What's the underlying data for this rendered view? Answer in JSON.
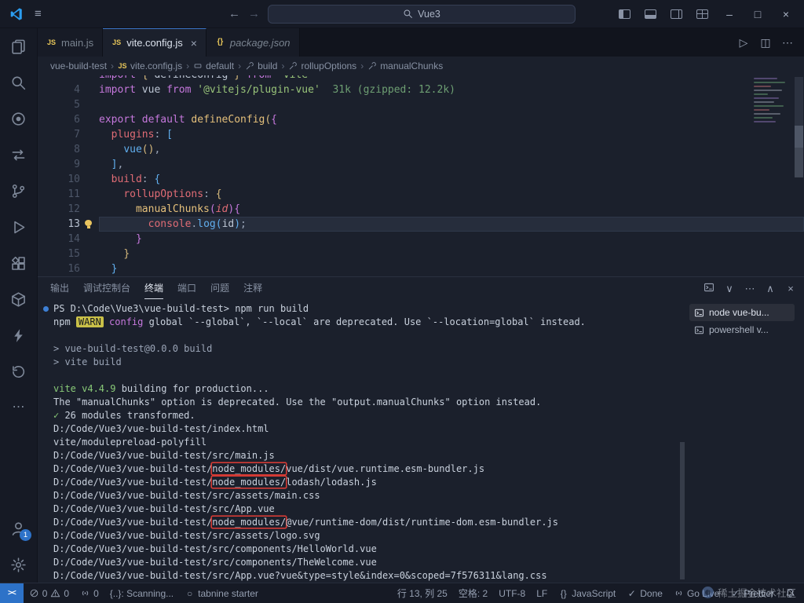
{
  "titlebar": {
    "menu_icon": "≡",
    "back": "←",
    "forward": "→",
    "search_value": "Vue3",
    "minimize": "–",
    "maximize": "□",
    "close": "×"
  },
  "activity_bar": {
    "top_items": [
      {
        "name": "explorer",
        "icon": "files"
      },
      {
        "name": "search",
        "icon": "search"
      },
      {
        "name": "chat",
        "icon": "chat"
      },
      {
        "name": "compare",
        "icon": "compare"
      },
      {
        "name": "source-control",
        "icon": "branch"
      },
      {
        "name": "run-debug",
        "icon": "debug"
      },
      {
        "name": "extensions",
        "icon": "extensions"
      },
      {
        "name": "package",
        "icon": "box"
      },
      {
        "name": "thunder-client",
        "icon": "bolt"
      },
      {
        "name": "history",
        "icon": "history"
      },
      {
        "name": "more-views",
        "icon": "kebab"
      }
    ],
    "bottom_items": [
      {
        "name": "accounts",
        "icon": "person",
        "badge": "1"
      },
      {
        "name": "settings",
        "icon": "gear"
      }
    ]
  },
  "editor_tabs": [
    {
      "label": "main.js",
      "icon": "js",
      "active": false
    },
    {
      "label": "vite.config.js",
      "icon": "js",
      "active": true,
      "close": "×"
    },
    {
      "label": "package.json",
      "icon": "json",
      "active": false,
      "preview": true
    }
  ],
  "tab_actions": [
    {
      "name": "run-file",
      "icon": "play"
    },
    {
      "name": "split-editor",
      "icon": "split"
    },
    {
      "name": "editor-more",
      "icon": "kebab"
    }
  ],
  "breadcrumbs": [
    {
      "label": "vue-build-test"
    },
    {
      "label": "vite.config.js",
      "icon": "js"
    },
    {
      "label": "default",
      "icon": "symbol-field"
    },
    {
      "label": "build",
      "icon": "wrench"
    },
    {
      "label": "rollupOptions",
      "icon": "wrench"
    },
    {
      "label": "manualChunks",
      "icon": "wrench"
    }
  ],
  "editor": {
    "active_line": 13,
    "partial_top_tokens": [
      [
        "kw",
        "import "
      ],
      [
        "bY",
        "{ "
      ],
      [
        "t",
        "defineConfig "
      ],
      [
        "bY",
        "} "
      ],
      [
        "kw",
        "from "
      ],
      [
        "str",
        "'vite'"
      ]
    ],
    "lines": [
      {
        "num": 4,
        "tokens": [
          [
            "kw",
            "import "
          ],
          [
            "t",
            "vue "
          ],
          [
            "kw",
            "from "
          ],
          [
            "str",
            "'@vitejs/plugin-vue'"
          ],
          [
            "hint",
            "  31k (gzipped: 12.2k)"
          ]
        ]
      },
      {
        "num": 5,
        "tokens": []
      },
      {
        "num": 6,
        "tokens": [
          [
            "kw",
            "export "
          ],
          [
            "kw",
            "default "
          ],
          [
            "fn",
            "defineConfig"
          ],
          [
            "bY",
            "("
          ],
          [
            "bP",
            "{"
          ]
        ]
      },
      {
        "num": 7,
        "tokens": [
          [
            "t",
            "  "
          ],
          [
            "prop",
            "plugins"
          ],
          [
            "pun",
            ": "
          ],
          [
            "bB",
            "["
          ]
        ]
      },
      {
        "num": 8,
        "tokens": [
          [
            "t",
            "    "
          ],
          [
            "fnb",
            "vue"
          ],
          [
            "bY",
            "()"
          ],
          [
            "pun",
            ","
          ]
        ]
      },
      {
        "num": 9,
        "tokens": [
          [
            "t",
            "  "
          ],
          [
            "bB",
            "]"
          ],
          [
            "pun",
            ","
          ]
        ]
      },
      {
        "num": 10,
        "tokens": [
          [
            "t",
            "  "
          ],
          [
            "prop",
            "build"
          ],
          [
            "pun",
            ": "
          ],
          [
            "bB",
            "{"
          ]
        ]
      },
      {
        "num": 11,
        "tokens": [
          [
            "t",
            "    "
          ],
          [
            "prop",
            "rollupOptions"
          ],
          [
            "pun",
            ": "
          ],
          [
            "bY",
            "{"
          ]
        ]
      },
      {
        "num": 12,
        "tokens": [
          [
            "t",
            "      "
          ],
          [
            "fn",
            "manualChunks"
          ],
          [
            "bP",
            "("
          ],
          [
            "param",
            "id"
          ],
          [
            "bP",
            ")"
          ],
          [
            "bP",
            "{"
          ]
        ]
      },
      {
        "num": 13,
        "tokens": [
          [
            "t",
            "        "
          ],
          [
            "obj",
            "console"
          ],
          [
            "pun",
            "."
          ],
          [
            "fnb",
            "log"
          ],
          [
            "bB",
            "("
          ],
          [
            "t",
            "id"
          ],
          [
            "bB",
            ")"
          ],
          [
            "pun",
            ";"
          ]
        ]
      },
      {
        "num": 14,
        "tokens": [
          [
            "t",
            "      "
          ],
          [
            "bP",
            "}"
          ]
        ]
      },
      {
        "num": 15,
        "tokens": [
          [
            "t",
            "    "
          ],
          [
            "bY",
            "}"
          ]
        ]
      },
      {
        "num": 16,
        "tokens": [
          [
            "t",
            "  "
          ],
          [
            "bB",
            "}"
          ]
        ]
      }
    ]
  },
  "panel": {
    "tabs": [
      {
        "label": "输出"
      },
      {
        "label": "调试控制台"
      },
      {
        "label": "终端",
        "active": true
      },
      {
        "label": "端口"
      },
      {
        "label": "问题"
      },
      {
        "label": "注释"
      }
    ],
    "actions": [
      {
        "name": "terminal-new",
        "icon": "terminal"
      },
      {
        "name": "terminal-dropdown",
        "icon": "chevron-down"
      },
      {
        "name": "panel-more",
        "icon": "kebab"
      },
      {
        "name": "panel-maximize",
        "icon": "chevron-up"
      },
      {
        "name": "panel-close",
        "icon": "close"
      }
    ],
    "terminal_lines": [
      {
        "decoration": true,
        "tokens": [
          [
            "t",
            "PS D:\\Code\\Vue3\\vue-build-test> npm run build"
          ]
        ]
      },
      {
        "tokens": [
          [
            "t",
            "npm "
          ],
          [
            "warn",
            "WARN"
          ],
          [
            "mag",
            " config "
          ],
          [
            "t",
            "global `--global`, `--local` are deprecated. Use `--location=global` instead."
          ]
        ]
      },
      {
        "tokens": []
      },
      {
        "tokens": [
          [
            "dim",
            "> vue-build-test@0.0.0 build"
          ]
        ]
      },
      {
        "tokens": [
          [
            "dim",
            "> vite build"
          ]
        ]
      },
      {
        "tokens": []
      },
      {
        "tokens": [
          [
            "green",
            "vite v4.4.9 "
          ],
          [
            "t",
            "building for production..."
          ]
        ]
      },
      {
        "tokens": [
          [
            "t",
            "The \"manualChunks\" option is deprecated. Use the \"output.manualChunks\" option instead."
          ]
        ]
      },
      {
        "tokens": [
          [
            "green",
            "✓ "
          ],
          [
            "t",
            "26 modules transformed."
          ]
        ]
      },
      {
        "tokens": [
          [
            "t",
            "D:/Code/Vue3/vue-build-test/index.html"
          ]
        ]
      },
      {
        "tokens": [
          [
            "t",
            "vite/modulepreload-polyfill"
          ]
        ]
      },
      {
        "tokens": [
          [
            "t",
            "D:/Code/Vue3/vue-build-test/src/main.js"
          ]
        ]
      },
      {
        "tokens": [
          [
            "t",
            "D:/Code/Vue3/vue-build-test/"
          ],
          [
            "rb",
            "node_modules/"
          ],
          [
            "t",
            "vue/dist/vue.runtime.esm-bundler.js"
          ]
        ]
      },
      {
        "tokens": [
          [
            "t",
            "D:/Code/Vue3/vue-build-test/"
          ],
          [
            "rb",
            "node_modules/"
          ],
          [
            "t",
            "lodash/lodash.js"
          ]
        ]
      },
      {
        "tokens": [
          [
            "t",
            "D:/Code/Vue3/vue-build-test/src/assets/main.css"
          ]
        ]
      },
      {
        "tokens": [
          [
            "t",
            "D:/Code/Vue3/vue-build-test/src/App.vue"
          ]
        ]
      },
      {
        "tokens": [
          [
            "t",
            "D:/Code/Vue3/vue-build-test/"
          ],
          [
            "rb",
            "node_modules/"
          ],
          [
            "t",
            "@vue/runtime-dom/dist/runtime-dom.esm-bundler.js"
          ]
        ]
      },
      {
        "tokens": [
          [
            "t",
            "D:/Code/Vue3/vue-build-test/src/assets/logo.svg"
          ]
        ]
      },
      {
        "tokens": [
          [
            "t",
            "D:/Code/Vue3/vue-build-test/src/components/HelloWorld.vue"
          ]
        ]
      },
      {
        "tokens": [
          [
            "t",
            "D:/Code/Vue3/vue-build-test/src/components/TheWelcome.vue"
          ]
        ]
      },
      {
        "tokens": [
          [
            "t",
            "D:/Code/Vue3/vue-build-test/src/App.vue?vue&type=style&index=0&scoped=7f576311&lang.css"
          ]
        ]
      }
    ],
    "sidebar_items": [
      {
        "label": "node vue-bu...",
        "icon": "terminal",
        "selected": true
      },
      {
        "label": "powershell v...",
        "icon": "terminal",
        "selected": false
      }
    ]
  },
  "statusbar": {
    "left": [
      {
        "name": "remote-window",
        "cls": "remote",
        "parts": [
          [
            "text",
            "><"
          ]
        ]
      },
      {
        "name": "problems",
        "parts": [
          [
            "icon",
            "error"
          ],
          [
            "text",
            "0"
          ],
          [
            "icon",
            "warning"
          ],
          [
            "text",
            "0"
          ]
        ]
      },
      {
        "name": "ports",
        "parts": [
          [
            "icon",
            "broadcast"
          ],
          [
            "text",
            "0"
          ]
        ]
      },
      {
        "name": "tabnine-scanning",
        "parts": [
          [
            "text",
            "{..}: Scanning..."
          ]
        ]
      },
      {
        "name": "tabnine-status",
        "parts": [
          [
            "icon",
            "dot-small"
          ],
          [
            "text",
            "tabnine starter"
          ]
        ]
      }
    ],
    "right": [
      {
        "name": "cursor-position",
        "parts": [
          [
            "text",
            "行 13, 列 25"
          ]
        ]
      },
      {
        "name": "indentation",
        "parts": [
          [
            "text",
            "空格: 2"
          ]
        ]
      },
      {
        "name": "encoding",
        "parts": [
          [
            "text",
            "UTF-8"
          ]
        ]
      },
      {
        "name": "eol",
        "parts": [
          [
            "text",
            "LF"
          ]
        ]
      },
      {
        "name": "language-mode",
        "parts": [
          [
            "icon",
            "braces"
          ],
          [
            "text",
            "JavaScript"
          ]
        ]
      },
      {
        "name": "done-status",
        "parts": [
          [
            "icon",
            "check"
          ],
          [
            "text",
            "Done"
          ]
        ]
      },
      {
        "name": "go-live",
        "parts": [
          [
            "icon",
            "broadcast"
          ],
          [
            "text",
            "Go Live"
          ]
        ]
      },
      {
        "name": "prettier",
        "parts": [
          [
            "icon",
            "check"
          ],
          [
            "text",
            "Prettier"
          ]
        ]
      },
      {
        "name": "notifications",
        "parts": [
          [
            "icon",
            "bell"
          ]
        ]
      }
    ]
  },
  "watermark": "稀土掘金技术社区"
}
